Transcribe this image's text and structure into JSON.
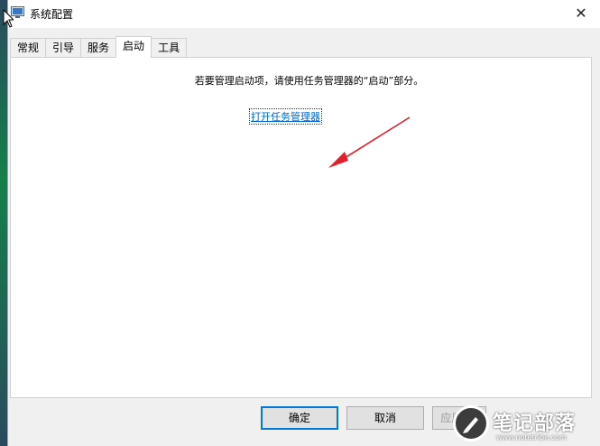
{
  "window": {
    "title": "系统配置",
    "close_glyph": "✕"
  },
  "tabs": [
    {
      "label": "常规"
    },
    {
      "label": "引导"
    },
    {
      "label": "服务"
    },
    {
      "label": "启动",
      "active": true
    },
    {
      "label": "工具"
    }
  ],
  "panel": {
    "message": "若要管理启动项，请使用任务管理器的“启动”部分。",
    "link_label": "打开任务管理器"
  },
  "footer": {
    "ok_label": "确定",
    "cancel_label": "取消",
    "apply_label": "应用(A)"
  },
  "watermark": {
    "brand": "笔记部落",
    "url": "www.notetribe.com"
  },
  "colors": {
    "accent": "#0078d7",
    "link": "#0066cc",
    "arrow": "#e0202a"
  }
}
